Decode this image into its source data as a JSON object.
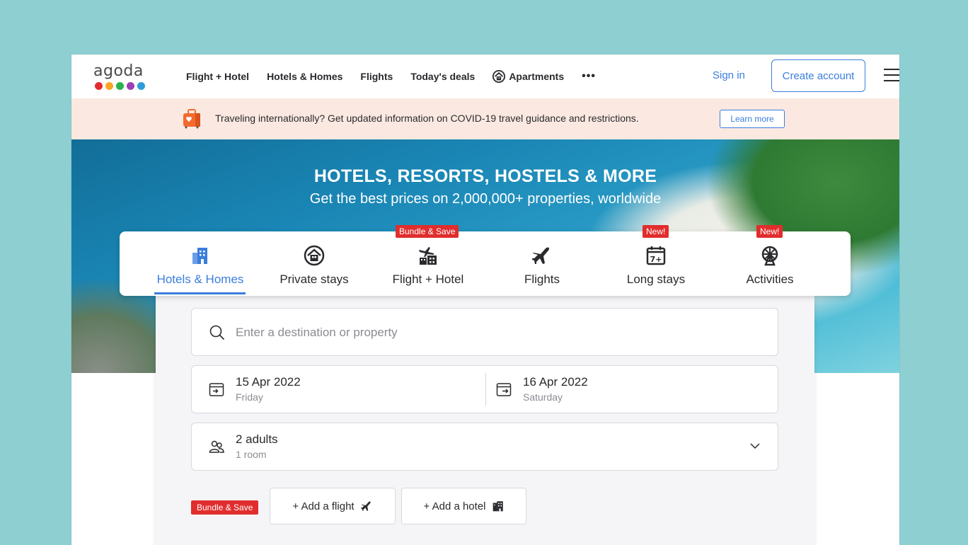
{
  "header": {
    "logo_text": "agoda",
    "logo_dots": [
      "#e12d2d",
      "#f5a623",
      "#2bb24c",
      "#9b3fb5",
      "#2d9cdb"
    ],
    "nav": [
      {
        "label": "Flight + Hotel"
      },
      {
        "label": "Hotels & Homes"
      },
      {
        "label": "Flights"
      },
      {
        "label": "Today's deals"
      },
      {
        "label": "Apartments",
        "icon": "apartment-icon"
      }
    ],
    "more_label": "•••",
    "sign_in": "Sign in",
    "create_account": "Create account"
  },
  "banner": {
    "text": "Traveling internationally? Get updated information on COVID-19 travel guidance and restrictions.",
    "button": "Learn more"
  },
  "hero": {
    "title": "HOTELS, RESORTS, HOSTELS & MORE",
    "subtitle": "Get the best prices on 2,000,000+ properties, worldwide"
  },
  "tabs": [
    {
      "label": "Hotels & Homes",
      "icon": "building-icon",
      "active": true
    },
    {
      "label": "Private stays",
      "icon": "house-icon"
    },
    {
      "label": "Flight + Hotel",
      "icon": "flight-hotel-icon",
      "badge": "Bundle & Save"
    },
    {
      "label": "Flights",
      "icon": "airplane-icon"
    },
    {
      "label": "Long stays",
      "icon": "calendar-7-icon",
      "badge": "New!"
    },
    {
      "label": "Activities",
      "icon": "ferris-wheel-icon",
      "badge": "New!"
    }
  ],
  "search": {
    "placeholder": "Enter a destination or property"
  },
  "dates": {
    "checkin": {
      "date": "15 Apr 2022",
      "day": "Friday"
    },
    "checkout": {
      "date": "16 Apr 2022",
      "day": "Saturday"
    }
  },
  "guests": {
    "main": "2 adults",
    "sub": "1 room"
  },
  "bundle": {
    "badge": "Bundle & Save",
    "add_flight": "+ Add a flight",
    "add_hotel": "+ Add a hotel"
  },
  "colors": {
    "accent": "#3b7ddd",
    "badge_red": "#e12d2d",
    "banner_bg": "#fbe9e1",
    "page_bg": "#8ecfd2"
  }
}
